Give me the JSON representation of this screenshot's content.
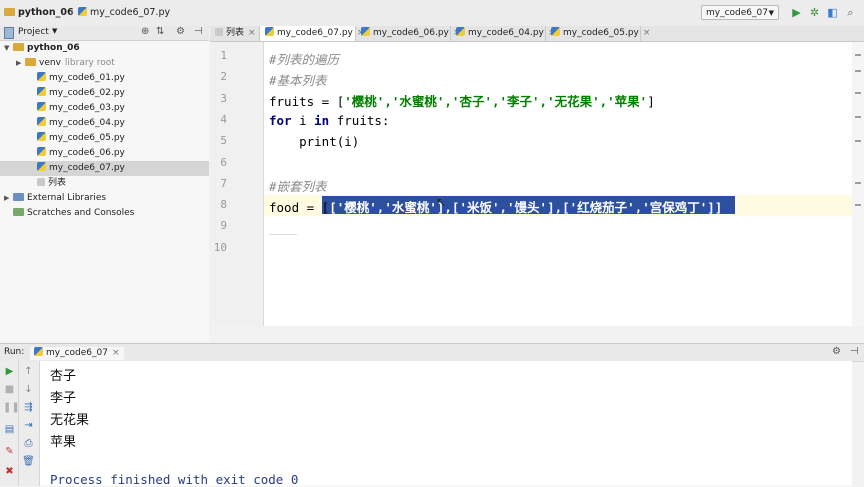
{
  "breadcrumb": {
    "project": "python_06",
    "file": "my_code6_07.py"
  },
  "run_config": {
    "label": "my_code6_07"
  },
  "project_panel": {
    "title": "Project",
    "tree": [
      {
        "label": "python_06",
        "kind": "folder",
        "indent": 0,
        "arrow": "▼",
        "bold": true
      },
      {
        "label": "venv",
        "note": "library root",
        "kind": "folder",
        "indent": 1,
        "arrow": "▶"
      },
      {
        "label": "my_code6_01.py",
        "kind": "py",
        "indent": 2
      },
      {
        "label": "my_code6_02.py",
        "kind": "py",
        "indent": 2
      },
      {
        "label": "my_code6_03.py",
        "kind": "py",
        "indent": 2
      },
      {
        "label": "my_code6_04.py",
        "kind": "py",
        "indent": 2
      },
      {
        "label": "my_code6_05.py",
        "kind": "py",
        "indent": 2
      },
      {
        "label": "my_code6_06.py",
        "kind": "py",
        "indent": 2
      },
      {
        "label": "my_code6_07.py",
        "kind": "py",
        "indent": 2,
        "selected": true
      },
      {
        "label": "列表",
        "kind": "file",
        "indent": 2
      },
      {
        "label": "External Libraries",
        "kind": "lib",
        "indent": 0,
        "arrow": "▶"
      },
      {
        "label": "Scratches and Consoles",
        "kind": "scratch",
        "indent": 0
      }
    ]
  },
  "tabs": [
    {
      "label": "列表",
      "active": false
    },
    {
      "label": "my_code6_07.py",
      "active": true
    },
    {
      "label": "my_code6_06.py",
      "active": false
    },
    {
      "label": "my_code6_04.py",
      "active": false
    },
    {
      "label": "my_code6_05.py",
      "active": false
    }
  ],
  "editor": {
    "line_numbers": [
      "1",
      "2",
      "3",
      "4",
      "5",
      "6",
      "7",
      "8",
      "9",
      "10"
    ],
    "comment_1": "#列表的遍历",
    "comment_2": "#基本列表",
    "line3_var": "fruits = [",
    "line3_items": "'樱桃','水蜜桃','杏子','李子','无花果','苹果'",
    "line3_end": "]",
    "line4_for": "for",
    "line4_mid": " i ",
    "line4_in": "in",
    "line4_rest": " fruits:",
    "line5": "    print(i)",
    "comment_7": "#嵌套列表",
    "line8_var": "food = [",
    "line8_selected": "['樱桃','水蜜桃'],['米饭','馒头'],['红烧茄子','宫保鸡丁']]"
  },
  "run_panel": {
    "label": "Run:",
    "config": "my_code6_07",
    "output": [
      "杏子",
      "李子",
      "无花果",
      "苹果"
    ],
    "exit_message": "Process finished with exit code 0"
  }
}
